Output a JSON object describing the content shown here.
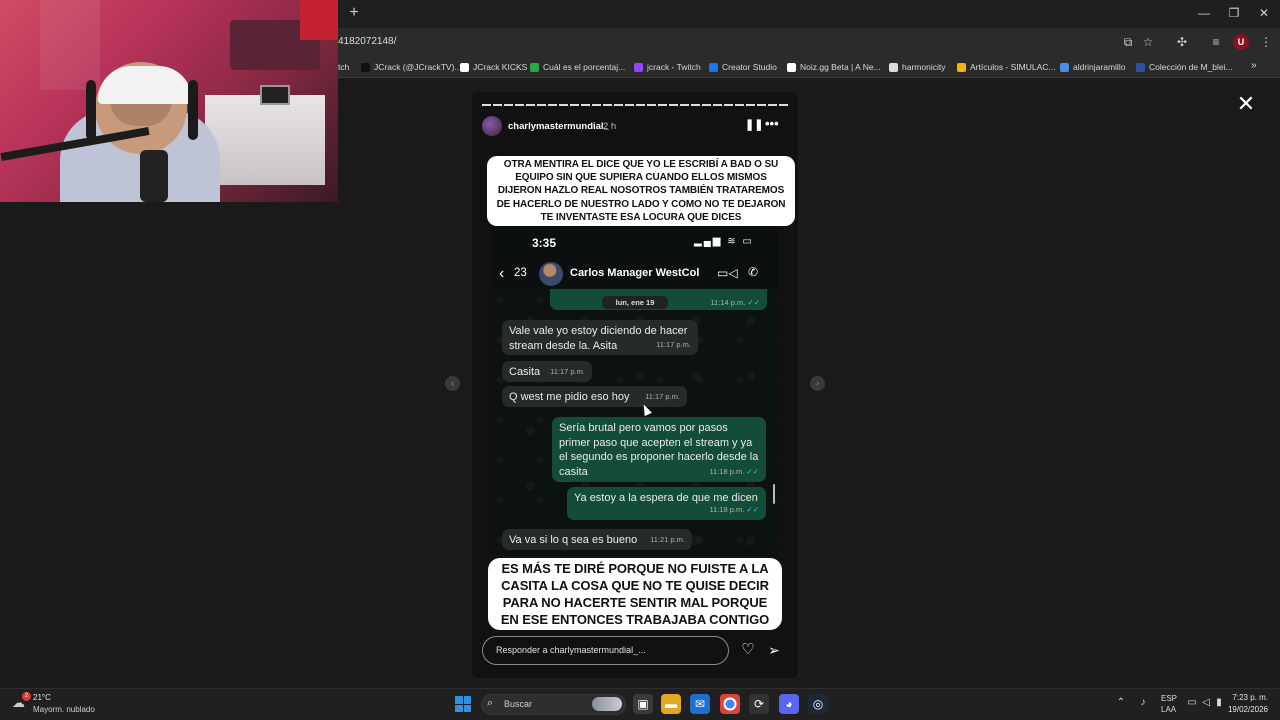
{
  "browser": {
    "url": "4182072148/",
    "new_tab": "+",
    "window_controls": [
      "—",
      "❐",
      "✕"
    ],
    "bookmarks": [
      {
        "label": "tch",
        "color": "#7b4fd0"
      },
      {
        "label": "JCrack (@JCrackTV)...",
        "color": "#111111"
      },
      {
        "label": "JCrack KICKS",
        "color": "#ffffff"
      },
      {
        "label": "Cuál es el porcentaj...",
        "color": "#2aa848"
      },
      {
        "label": "jcrack - Twitch",
        "color": "#9146ff"
      },
      {
        "label": "Creator Studio",
        "color": "#1877f2"
      },
      {
        "label": "Noiz.gg Beta | A Ne...",
        "color": "#ffffff"
      },
      {
        "label": "harmonicity",
        "color": "#dddddd"
      },
      {
        "label": "Artículos - SIMULAC...",
        "color": "#f4b400"
      },
      {
        "label": "aldrinjaramillo",
        "color": "#4a90e2"
      },
      {
        "label": "Colección de M_blei...",
        "color": "#2f4fa0"
      }
    ],
    "more_bookmarks": "»"
  },
  "story": {
    "username": "charlymastermundial_",
    "time": "2 h",
    "caption_top": "OTRA MENTIRA EL DICE QUE YO LE ESCRIBÍ A BAD O SU EQUIPO SIN QUE SUPIERA CUANDO ELLOS MISMOS DIJERON HAZLO REAL NOSOTROS TAMBIÉN TRATAREMOS DE HACERLO DE NUESTRO LADO Y COMO NO TE DEJARON TE INVENTASTE ESA LOCURA QUE DICES",
    "caption_bottom": "ES MÁS TE DIRÉ PORQUE NO FUISTE A LA CASITA LA COSA QUE NO TE QUISE DECIR PARA NO HACERTE SENTIR MAL PORQUE EN ESE ENTONCES TRABAJABA CONTIGO",
    "reply_placeholder": "Responder a charlymastermundial_..."
  },
  "chat": {
    "status_time": "3:35",
    "back_count": "23",
    "contact_name": "Carlos Manager WestCol",
    "date_label": "lun, ene 19",
    "prev_time": "11:14 p.m.",
    "messages": [
      {
        "dir": "in",
        "text": "Vale vale yo estoy diciendo de hacer stream desde la. Asita",
        "time": "11:17 p.m."
      },
      {
        "dir": "in",
        "text": "Casita",
        "time": "11:17 p.m."
      },
      {
        "dir": "in",
        "text": "Q west me pidio eso hoy",
        "time": "11:17 p.m."
      },
      {
        "dir": "out",
        "text": "Sería brutal pero vamos por pasos primer paso que acepten el stream y ya el segundo es proponer hacerlo desde la casita",
        "time": "11:18 p.m."
      },
      {
        "dir": "out",
        "text": "Ya estoy a la espera de que me dicen",
        "time": "11:18 p.m."
      },
      {
        "dir": "in",
        "text": "Va va si lo q sea es bueno",
        "time": "11:21 p.m."
      }
    ]
  },
  "taskbar": {
    "weather_temp": "21°C",
    "weather_desc": "Mayorm. nublado",
    "weather_badge": "2",
    "search_placeholder": "Buscar",
    "lang1": "ESP",
    "lang2": "LAA",
    "time": "7:23 p. m.",
    "date": "19/02/2026"
  },
  "colors": {
    "outgoing_bubble": "#144d37",
    "incoming_bubble": "#262a2b",
    "read_ticks": "#53bdeb",
    "accent_windows": "#2f8fe6"
  }
}
